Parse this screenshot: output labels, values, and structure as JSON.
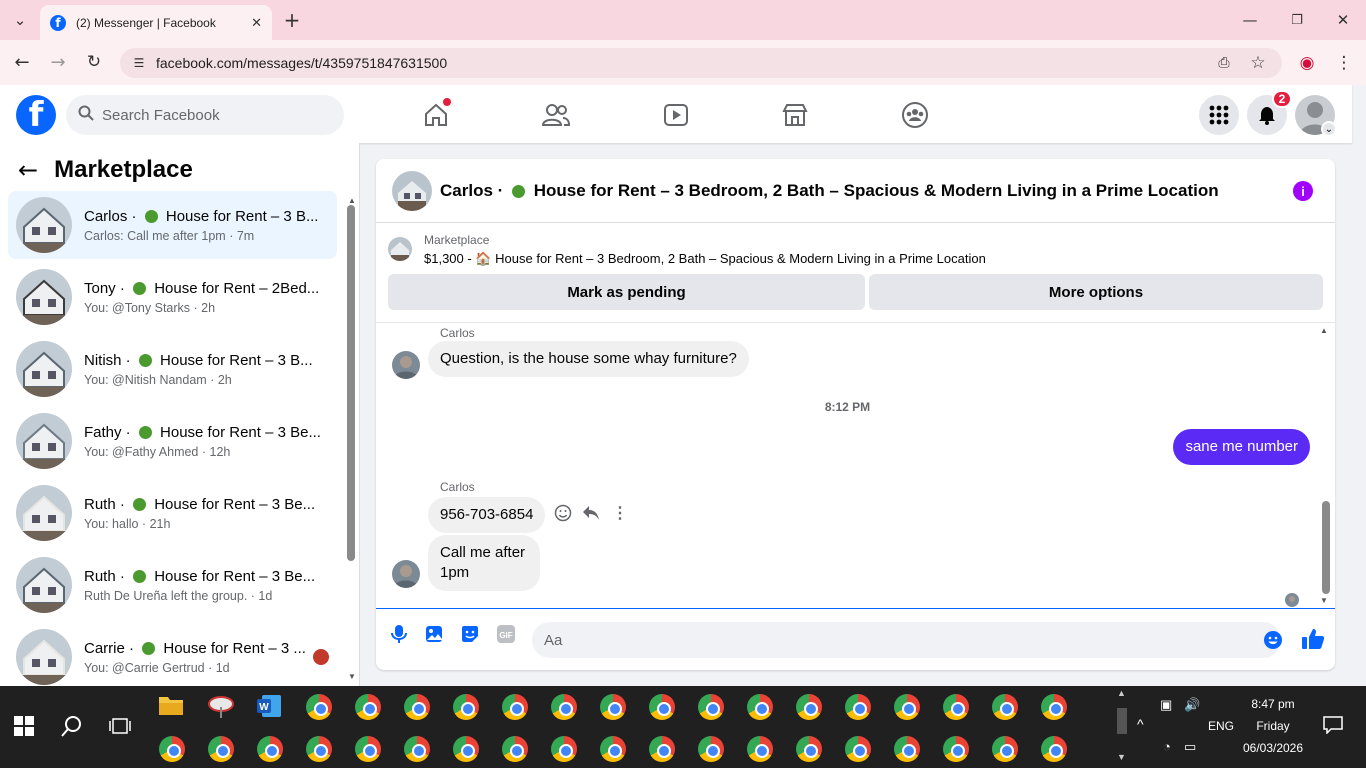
{
  "browser": {
    "tab_title": "(2) Messenger | Facebook",
    "url": "facebook.com/messages/t/4359751847631500"
  },
  "header": {
    "search_placeholder": "Search Facebook",
    "notification_count": "2"
  },
  "sidebar": {
    "title": "Marketplace",
    "conversations": [
      {
        "name": "Carlos",
        "title": "House for Rent – 3 B...",
        "preview": "Carlos: Call me after 1pm",
        "time": "7m"
      },
      {
        "name": "Tony",
        "title": "House for Rent – 2Bed...",
        "preview": "You: @Tony Starks",
        "time": "2h"
      },
      {
        "name": "Nitish",
        "title": "House for Rent – 3 B...",
        "preview": "You: @Nitish Nandam",
        "time": "2h"
      },
      {
        "name": "Fathy",
        "title": "House for Rent – 3 Be...",
        "preview": "You: @Fathy Ahmed",
        "time": "12h"
      },
      {
        "name": "Ruth",
        "title": "House for Rent – 3 Be...",
        "preview": "You: hallo",
        "time": "21h"
      },
      {
        "name": "Ruth",
        "title": "House for Rent – 3 Be...",
        "preview": "Ruth De Ureña left the group.",
        "time": "1d"
      },
      {
        "name": "Carrie",
        "title": "House for Rent – 3 ...",
        "preview": "You: @Carrie Gertrud",
        "time": "1d"
      }
    ]
  },
  "chat": {
    "header_name": "Carlos",
    "header_title": "House for Rent – 3 Bedroom, 2 Bath – Spacious & Modern Living in a Prime Location",
    "marketplace_label": "Marketplace",
    "listing_price": "$1,300 -",
    "listing_title": "House for Rent – 3 Bedroom, 2 Bath – Spacious & Modern Living in a Prime Location",
    "btn_pending": "Mark as pending",
    "btn_more": "More options",
    "messages": [
      {
        "sender": "Carlos",
        "text": "Question, is the house some whay furniture?"
      },
      {
        "timestamp": "8:12 PM"
      },
      {
        "sender": "me",
        "text": "sane me number"
      },
      {
        "sender": "Carlos",
        "text": "956-703-6854"
      },
      {
        "sender": "Carlos",
        "text": "Call me after 1pm"
      }
    ],
    "input_placeholder": "Aa"
  },
  "taskbar": {
    "time": "8:47 pm",
    "day": "Friday",
    "date": "06/03/2026",
    "lang": "ENG"
  },
  "colors": {
    "fb_blue": "#0866ff",
    "my_bubble": "#5b2bf5",
    "info_purple": "#a100ff",
    "tabbar": "#f9d7e0"
  }
}
